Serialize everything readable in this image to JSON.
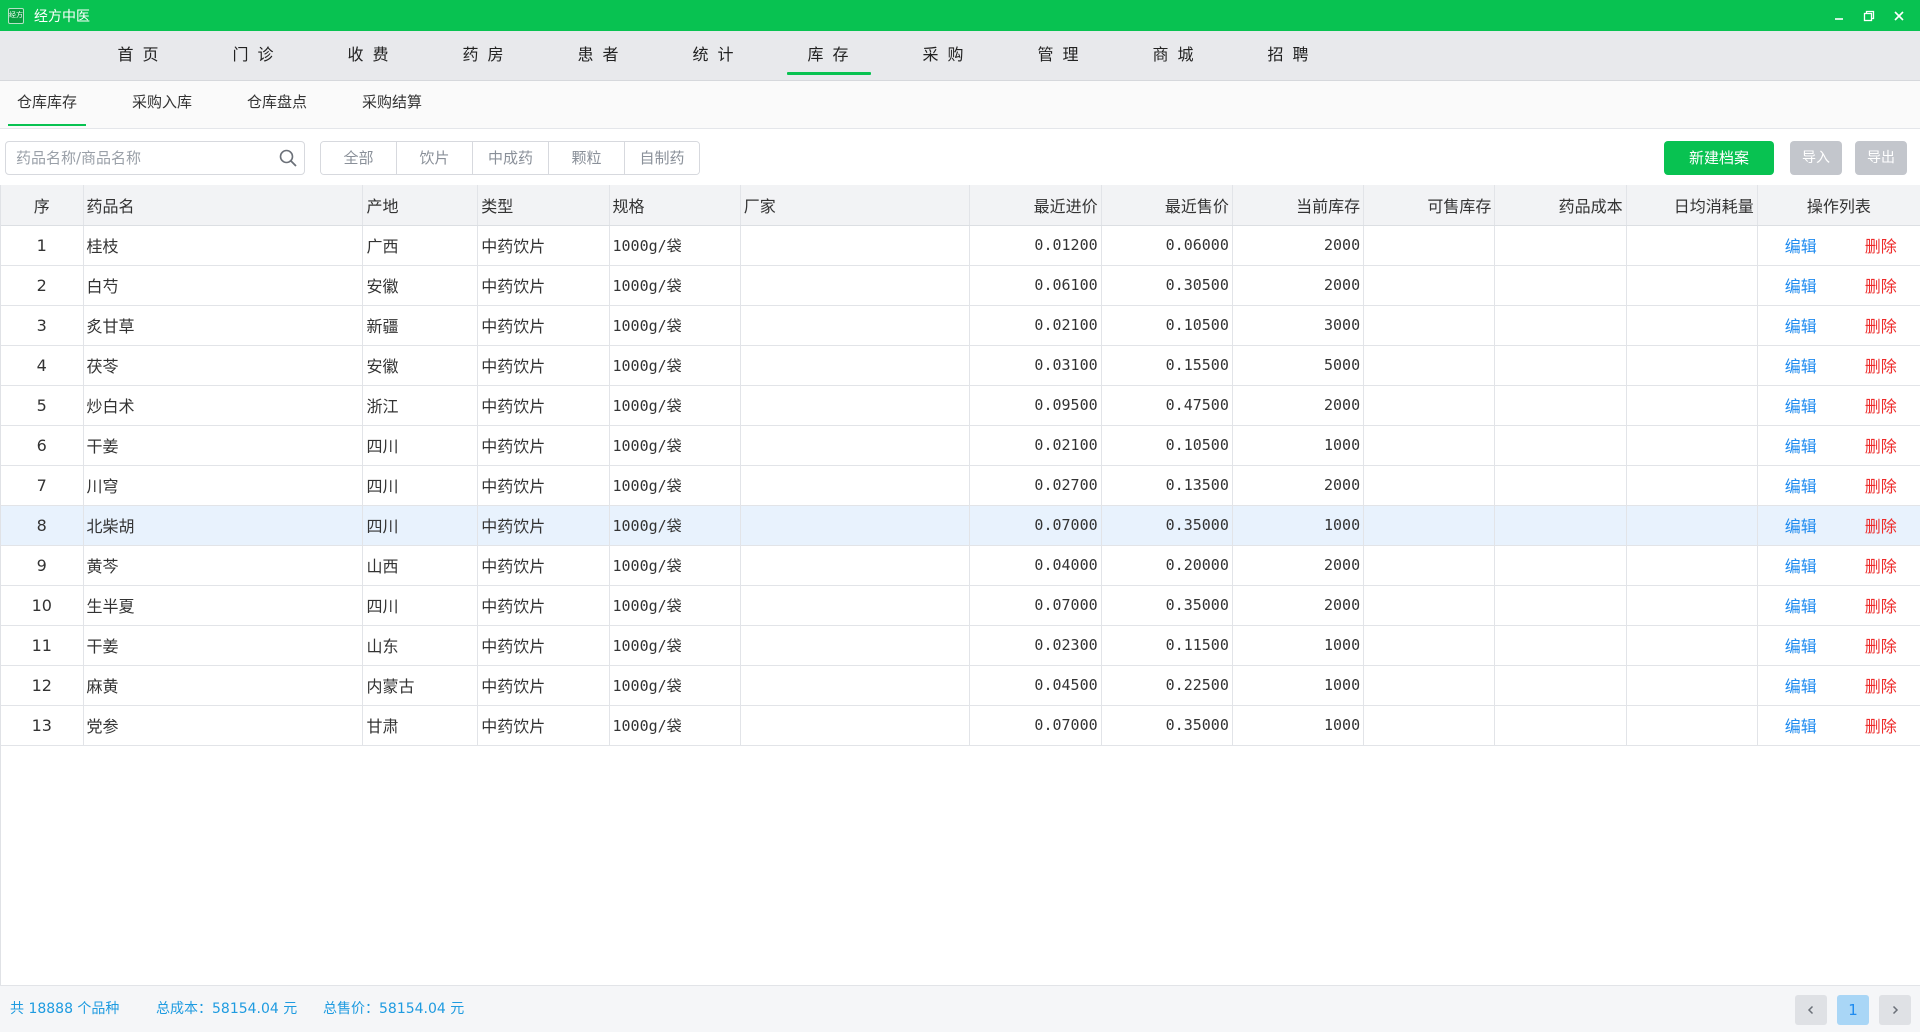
{
  "window": {
    "title": "经方中医",
    "icon_text": "经方",
    "controls": [
      "minimize-icon",
      "restore-icon",
      "close-icon"
    ]
  },
  "main_nav": [
    {
      "label": "首 页"
    },
    {
      "label": "门 诊"
    },
    {
      "label": "收 费"
    },
    {
      "label": "药 房"
    },
    {
      "label": "患 者"
    },
    {
      "label": "统 计"
    },
    {
      "label": "库 存",
      "active": true
    },
    {
      "label": "采 购"
    },
    {
      "label": "管 理"
    },
    {
      "label": "商 城"
    },
    {
      "label": "招 聘"
    }
  ],
  "sub_tabs": [
    {
      "label": "仓库库存",
      "active": true
    },
    {
      "label": "采购入库"
    },
    {
      "label": "仓库盘点"
    },
    {
      "label": "采购结算"
    }
  ],
  "toolbar": {
    "search_placeholder": "药品名称/商品名称",
    "search_icon": "search-icon",
    "filters": [
      "全部",
      "饮片",
      "中成药",
      "颗粒",
      "自制药"
    ],
    "new_label": "新建档案",
    "import_label": "导入",
    "export_label": "导出"
  },
  "table": {
    "columns": [
      "序",
      "药品名",
      "产地",
      "类型",
      "规格",
      "厂家",
      "最近进价",
      "最近售价",
      "当前库存",
      "可售库存",
      "药品成本",
      "日均消耗量",
      "操作列表"
    ],
    "edit_label": "编辑",
    "delete_label": "删除",
    "selected_row": 8,
    "rows": [
      {
        "no": "1",
        "name": "桂枝",
        "origin": "广西",
        "type": "中药饮片",
        "spec": "1000g/袋",
        "maker": "",
        "buy": "0.01200",
        "sell": "0.06000",
        "stock": "2000",
        "avail": "",
        "cost": "",
        "daily": ""
      },
      {
        "no": "2",
        "name": "白芍",
        "origin": "安徽",
        "type": "中药饮片",
        "spec": "1000g/袋",
        "maker": "",
        "buy": "0.06100",
        "sell": "0.30500",
        "stock": "2000",
        "avail": "",
        "cost": "",
        "daily": ""
      },
      {
        "no": "3",
        "name": "炙甘草",
        "origin": "新疆",
        "type": "中药饮片",
        "spec": "1000g/袋",
        "maker": "",
        "buy": "0.02100",
        "sell": "0.10500",
        "stock": "3000",
        "avail": "",
        "cost": "",
        "daily": ""
      },
      {
        "no": "4",
        "name": "茯苓",
        "origin": "安徽",
        "type": "中药饮片",
        "spec": "1000g/袋",
        "maker": "",
        "buy": "0.03100",
        "sell": "0.15500",
        "stock": "5000",
        "avail": "",
        "cost": "",
        "daily": ""
      },
      {
        "no": "5",
        "name": "炒白术",
        "origin": "浙江",
        "type": "中药饮片",
        "spec": "1000g/袋",
        "maker": "",
        "buy": "0.09500",
        "sell": "0.47500",
        "stock": "2000",
        "avail": "",
        "cost": "",
        "daily": ""
      },
      {
        "no": "6",
        "name": "干姜",
        "origin": "四川",
        "type": "中药饮片",
        "spec": "1000g/袋",
        "maker": "",
        "buy": "0.02100",
        "sell": "0.10500",
        "stock": "1000",
        "avail": "",
        "cost": "",
        "daily": ""
      },
      {
        "no": "7",
        "name": "川穹",
        "origin": "四川",
        "type": "中药饮片",
        "spec": "1000g/袋",
        "maker": "",
        "buy": "0.02700",
        "sell": "0.13500",
        "stock": "2000",
        "avail": "",
        "cost": "",
        "daily": ""
      },
      {
        "no": "8",
        "name": "北柴胡",
        "origin": "四川",
        "type": "中药饮片",
        "spec": "1000g/袋",
        "maker": "",
        "buy": "0.07000",
        "sell": "0.35000",
        "stock": "1000",
        "avail": "",
        "cost": "",
        "daily": ""
      },
      {
        "no": "9",
        "name": "黄芩",
        "origin": "山西",
        "type": "中药饮片",
        "spec": "1000g/袋",
        "maker": "",
        "buy": "0.04000",
        "sell": "0.20000",
        "stock": "2000",
        "avail": "",
        "cost": "",
        "daily": ""
      },
      {
        "no": "10",
        "name": "生半夏",
        "origin": "四川",
        "type": "中药饮片",
        "spec": "1000g/袋",
        "maker": "",
        "buy": "0.07000",
        "sell": "0.35000",
        "stock": "2000",
        "avail": "",
        "cost": "",
        "daily": ""
      },
      {
        "no": "11",
        "name": "干姜",
        "origin": "山东",
        "type": "中药饮片",
        "spec": "1000g/袋",
        "maker": "",
        "buy": "0.02300",
        "sell": "0.11500",
        "stock": "1000",
        "avail": "",
        "cost": "",
        "daily": ""
      },
      {
        "no": "12",
        "name": "麻黄",
        "origin": "内蒙古",
        "type": "中药饮片",
        "spec": "1000g/袋",
        "maker": "",
        "buy": "0.04500",
        "sell": "0.22500",
        "stock": "1000",
        "avail": "",
        "cost": "",
        "daily": ""
      },
      {
        "no": "13",
        "name": "党参",
        "origin": "甘肃",
        "type": "中药饮片",
        "spec": "1000g/袋",
        "maker": "",
        "buy": "0.07000",
        "sell": "0.35000",
        "stock": "1000",
        "avail": "",
        "cost": "",
        "daily": ""
      }
    ]
  },
  "footer": {
    "total_items": "共 18888 个品种",
    "total_cost": "总成本：58154.04 元",
    "total_price": "总售价：58154.04 元",
    "prev_icon": "chevron-left-icon",
    "next_icon": "chevron-right-icon",
    "current_page": "1"
  }
}
